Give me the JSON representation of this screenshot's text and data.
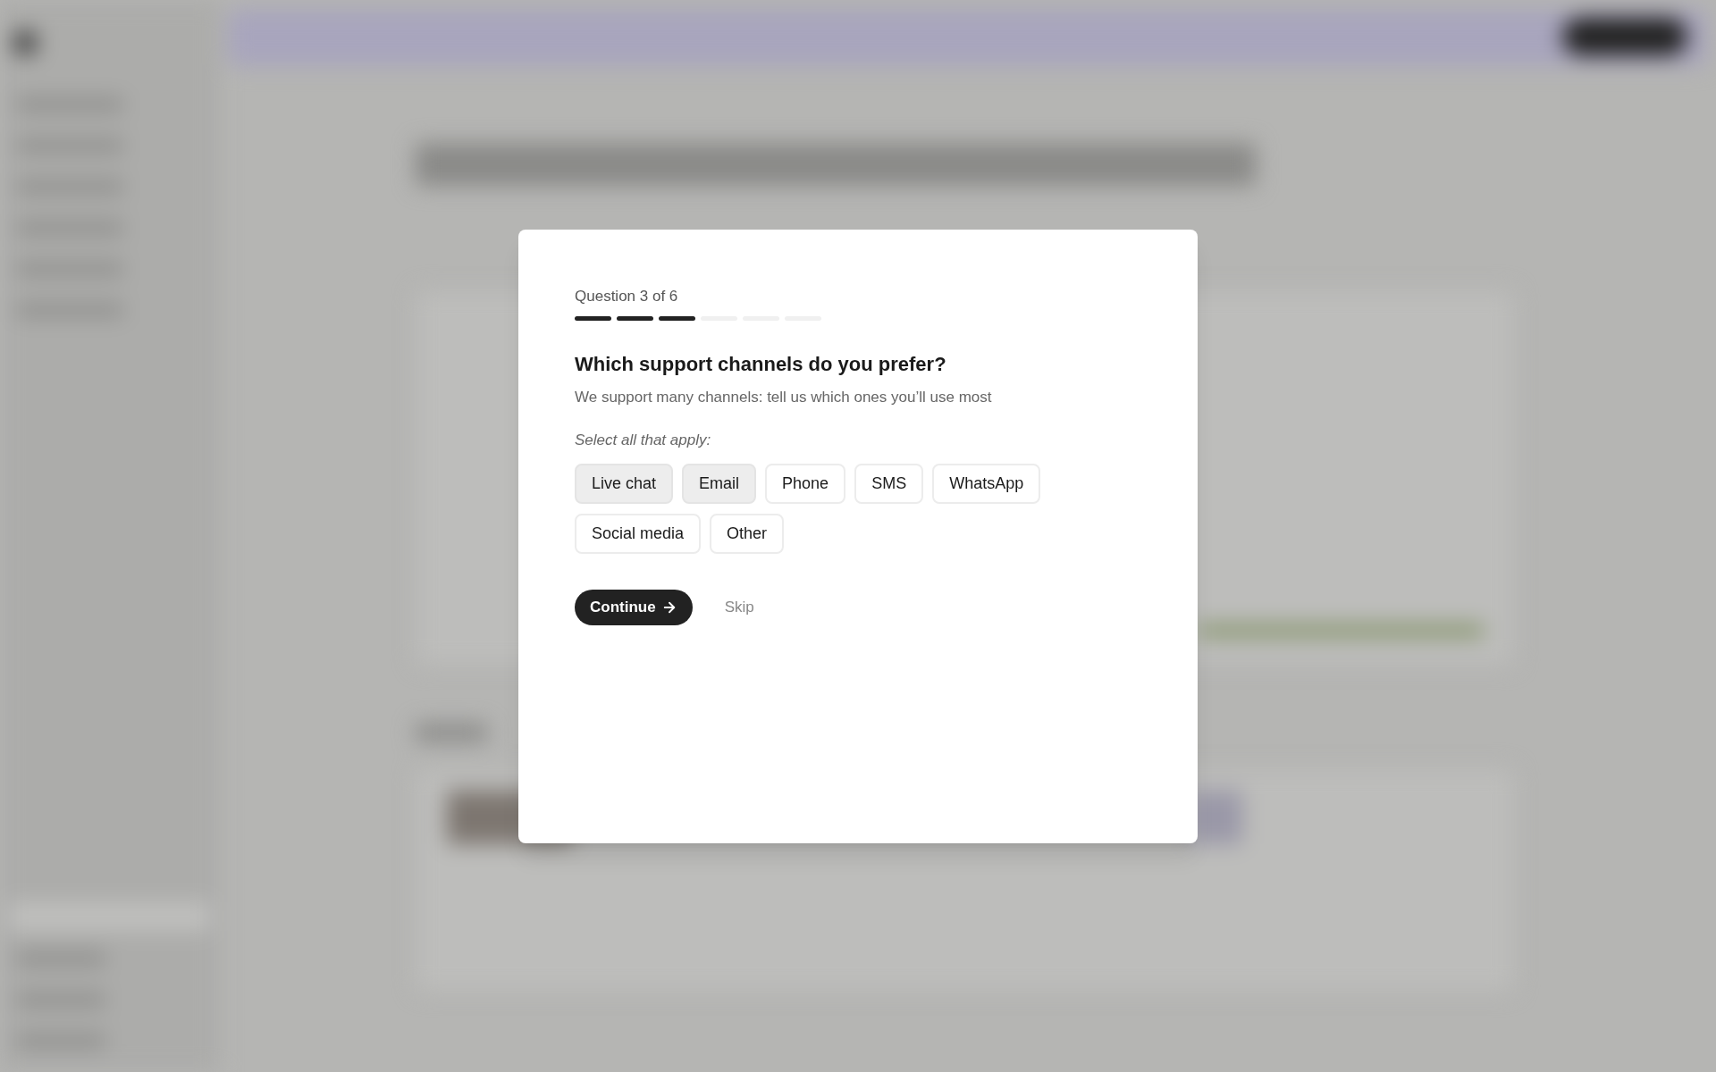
{
  "dialog": {
    "counter": "Question 3 of 6",
    "progress": [
      {
        "filled": true
      },
      {
        "filled": true
      },
      {
        "filled": true
      },
      {
        "filled": false
      },
      {
        "filled": false
      },
      {
        "filled": false
      }
    ],
    "question": "Which support channels do you prefer?",
    "description": "We support many channels: tell us which ones you’ll use most",
    "instruction": "Select all that apply:",
    "options": [
      {
        "label": "Live chat",
        "selected": true
      },
      {
        "label": "Email",
        "selected": true
      },
      {
        "label": "Phone",
        "selected": false
      },
      {
        "label": "SMS",
        "selected": false
      },
      {
        "label": "WhatsApp",
        "selected": false
      },
      {
        "label": "Social media",
        "selected": false
      },
      {
        "label": "Other",
        "selected": false
      }
    ],
    "continue_button": "Continue",
    "skip_button": "Skip"
  }
}
